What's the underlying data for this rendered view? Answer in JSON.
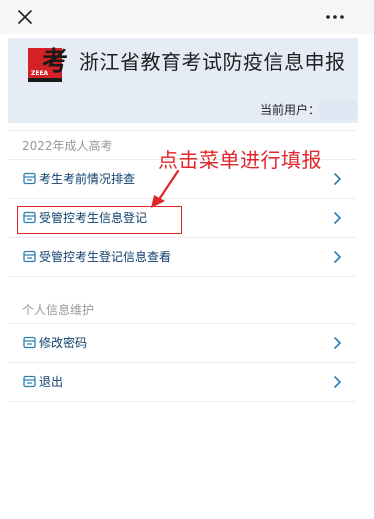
{
  "banner": {
    "title": "浙江省教育考试防疫信息申报",
    "user_label": "当前用户：",
    "logo_char": "考",
    "logo_text": "ZEEA"
  },
  "sections": [
    {
      "label": "2022年成人高考",
      "items": [
        {
          "label": "考生考前情况排查"
        },
        {
          "label": "受管控考生信息登记"
        },
        {
          "label": "受管控考生登记信息查看"
        }
      ]
    },
    {
      "label": "个人信息维护",
      "items": [
        {
          "label": "修改密码"
        },
        {
          "label": "退出"
        }
      ]
    }
  ],
  "annotation": {
    "text": "点击菜单进行填报",
    "color": "#e0262b"
  },
  "colors": {
    "menu_text": "#0e3f6b",
    "icon": "#2a7fb0",
    "banner_bg": "#e6ecf6",
    "section_label": "#999999"
  },
  "icons": {
    "top_left": "close-icon",
    "top_right": "more-options-icon",
    "menu": "form-icon",
    "menu_right": "chevron-right-icon"
  }
}
